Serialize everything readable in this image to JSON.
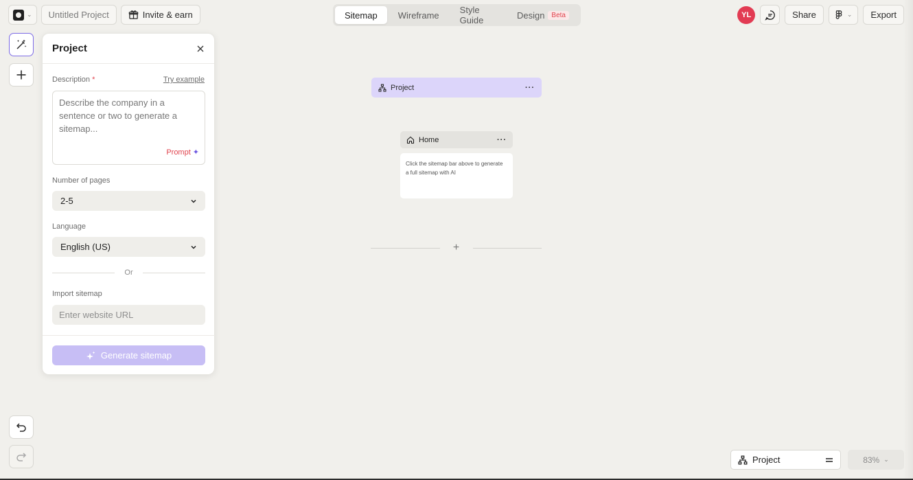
{
  "topbar": {
    "project_name": "Untitled Project",
    "invite_label": "Invite & earn",
    "tabs": [
      {
        "label": "Sitemap",
        "active": true
      },
      {
        "label": "Wireframe",
        "active": false
      },
      {
        "label": "Style Guide",
        "active": false
      },
      {
        "label": "Design",
        "active": false,
        "badge": "Beta"
      }
    ],
    "avatar_initials": "YL",
    "share_label": "Share",
    "export_label": "Export"
  },
  "panel": {
    "title": "Project",
    "description_label": "Description",
    "required_mark": "*",
    "try_example_label": "Try example",
    "description_placeholder": "Describe the company in a sentence or two to generate a sitemap...",
    "prompt_label": "Prompt",
    "pages_label": "Number of pages",
    "pages_value": "2-5",
    "language_label": "Language",
    "language_value": "English (US)",
    "or_label": "Or",
    "import_label": "Import sitemap",
    "url_placeholder": "Enter website URL",
    "generate_label": "Generate sitemap"
  },
  "canvas": {
    "project_node_label": "Project",
    "home_node_label": "Home",
    "home_node_hint": "Click the sitemap bar above to generate a full sitemap with AI"
  },
  "bottombar": {
    "sitemap_select_value": "Project",
    "zoom_value": "83%"
  },
  "colors": {
    "accent_purple": "#7c6ae6",
    "project_bar_bg": "#dcd5fa",
    "generate_button_bg": "#c7bef5",
    "avatar_bg": "#e23b53",
    "beta_red": "#e0424c",
    "canvas_bg": "#f1f0ec"
  }
}
